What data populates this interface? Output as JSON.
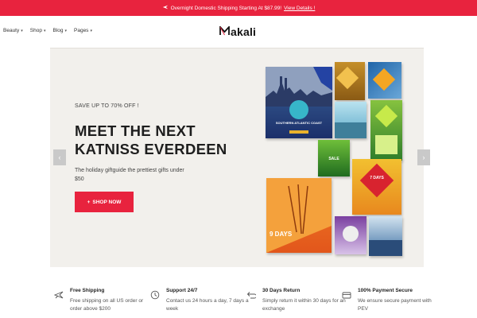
{
  "announcement": {
    "text": "Overnight Domestic Shipping Starting At $87.99!",
    "link": "View Details !"
  },
  "nav": {
    "items": [
      {
        "label": "Beauty"
      },
      {
        "label": "Shop"
      },
      {
        "label": "Blog"
      },
      {
        "label": "Pages"
      }
    ]
  },
  "logo": {
    "text": "akali"
  },
  "hero": {
    "subtitle": "SAVE UP TO 70% OFF !",
    "title_line1": "MEET THE NEXT",
    "title_line2": "KATNISS EVERDEEN",
    "description": "The holiday giftguide the prettiest gifts under $50",
    "button_label": "SHOP NOW",
    "button_icon": "+"
  },
  "collage": {
    "main_card_text": "SOUTHERN ATLANTIC COAST",
    "days_card_text": "9 DAYS",
    "seven_days_text": "7 DAYS",
    "sale_text": "SALE"
  },
  "features": [
    {
      "icon": "airplane-icon",
      "title": "Free Shipping",
      "desc": "Free shipping on all US order or order above $200"
    },
    {
      "icon": "clock-icon",
      "title": "Support 24/7",
      "desc": "Contact us 24 hours a day, 7 days a week"
    },
    {
      "icon": "return-icon",
      "title": "30 Days Return",
      "desc": "Simply return it within 30 days for an exchange"
    },
    {
      "icon": "card-icon",
      "title": "100% Payment Secure",
      "desc": "We ensure secure payment with PEV"
    }
  ],
  "colors": {
    "accent": "#e8233e",
    "hero_bg": "#f2f0ec"
  }
}
